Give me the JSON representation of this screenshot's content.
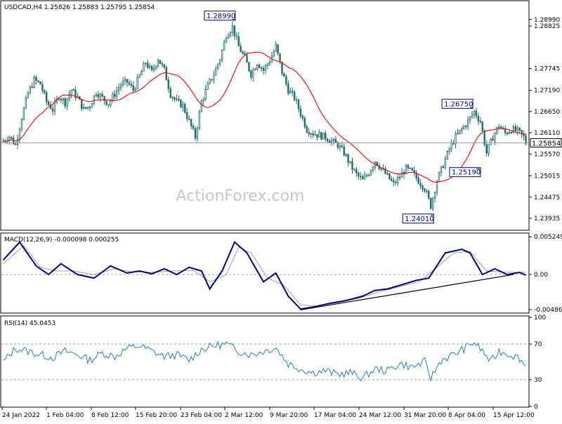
{
  "watermark": "ActionForex.com",
  "colors": {
    "candle": "#1f6f6f",
    "ma": "#ff0000",
    "macd": "#000080",
    "signal": "#a0a0a0",
    "rsi": "#1e7fd0",
    "callout": "#000080",
    "gridline": "#a0a0a0"
  },
  "chart_data": [
    {
      "type": "candlestick",
      "title": "USDCAD,H4  1.25826 1.25883 1.25795 1.25854",
      "ylim": [
        1.2365,
        1.2945
      ],
      "yticks": [
        "1.28990",
        "1.28825",
        "1.27745",
        "1.27190",
        "1.26650",
        "1.26110",
        "1.25570",
        "1.25015",
        "1.24475",
        "1.23935"
      ],
      "xticks": [
        "24 Jan 2022",
        "1 Feb 04:00",
        "8 Feb 12:00",
        "15 Feb 20:00",
        "23 Feb 04:00",
        "2 Mar 12:00",
        "9 Mar 20:00",
        "17 Mar 04:00",
        "24 Mar 12:00",
        "31 Mar 20:00",
        "8 Apr 04:00",
        "15 Apr 12:00"
      ],
      "current_price": "1.25854",
      "annotations": [
        {
          "label": "1.28990",
          "value": 1.2899
        },
        {
          "label": "1.26750",
          "value": 1.2675
        },
        {
          "label": "1.25190",
          "value": 1.2519
        },
        {
          "label": "1.24010",
          "value": 1.2401
        }
      ],
      "close_path": [
        [
          0,
          1.259
        ],
        [
          3,
          1.2602
        ],
        [
          6,
          1.258
        ],
        [
          9,
          1.265
        ],
        [
          12,
          1.2712
        ],
        [
          15,
          1.2745
        ],
        [
          18,
          1.2735
        ],
        [
          21,
          1.269
        ],
        [
          24,
          1.267
        ],
        [
          27,
          1.2705
        ],
        [
          30,
          1.2688
        ],
        [
          33,
          1.272
        ],
        [
          36,
          1.27
        ],
        [
          39,
          1.267
        ],
        [
          42,
          1.268
        ],
        [
          45,
          1.2715
        ],
        [
          48,
          1.27
        ],
        [
          51,
          1.2685
        ],
        [
          54,
          1.271
        ],
        [
          57,
          1.2735
        ],
        [
          60,
          1.274
        ],
        [
          63,
          1.272
        ],
        [
          66,
          1.2755
        ],
        [
          69,
          1.279
        ],
        [
          72,
          1.2765
        ],
        [
          75,
          1.28
        ],
        [
          78,
          1.277
        ],
        [
          81,
          1.271
        ],
        [
          84,
          1.269
        ],
        [
          87,
          1.268
        ],
        [
          90,
          1.264
        ],
        [
          93,
          1.26
        ],
        [
          96,
          1.269
        ],
        [
          99,
          1.273
        ],
        [
          102,
          1.276
        ],
        [
          105,
          1.28
        ],
        [
          108,
          1.286
        ],
        [
          111,
          1.288
        ],
        [
          114,
          1.283
        ],
        [
          117,
          1.28
        ],
        [
          120,
          1.276
        ],
        [
          123,
          1.279
        ],
        [
          126,
          1.277
        ],
        [
          129,
          1.2795
        ],
        [
          132,
          1.283
        ],
        [
          135,
          1.2765
        ],
        [
          138,
          1.272
        ],
        [
          141,
          1.27
        ],
        [
          144,
          1.266
        ],
        [
          147,
          1.262
        ],
        [
          150,
          1.261
        ],
        [
          153,
          1.2605
        ],
        [
          156,
          1.26
        ],
        [
          159,
          1.259
        ],
        [
          162,
          1.258
        ],
        [
          165,
          1.256
        ],
        [
          168,
          1.253
        ],
        [
          171,
          1.2505
        ],
        [
          174,
          1.249
        ],
        [
          177,
          1.251
        ],
        [
          180,
          1.254
        ],
        [
          183,
          1.252
        ],
        [
          186,
          1.25
        ],
        [
          189,
          1.248
        ],
        [
          192,
          1.25
        ],
        [
          195,
          1.252
        ],
        [
          198,
          1.251
        ],
        [
          201,
          1.249
        ],
        [
          204,
          1.247
        ],
        [
          207,
          1.2425
        ],
        [
          210,
          1.249
        ],
        [
          213,
          1.253
        ],
        [
          216,
          1.257
        ],
        [
          219,
          1.26
        ],
        [
          222,
          1.262
        ],
        [
          225,
          1.264
        ],
        [
          228,
          1.2665
        ],
        [
          231,
          1.264
        ],
        [
          234,
          1.256
        ],
        [
          237,
          1.26
        ],
        [
          240,
          1.263
        ],
        [
          243,
          1.261
        ],
        [
          246,
          1.262
        ],
        [
          249,
          1.2615
        ],
        [
          252,
          1.26
        ],
        [
          253,
          1.2585
        ]
      ]
    },
    {
      "type": "line",
      "title": "MACD(12,26,9) -0.000098 0.000255",
      "ylim": [
        -0.00525,
        0.00556
      ],
      "yticks": [
        "0.005249",
        "0.00",
        "-0.004865"
      ],
      "series": [
        {
          "name": "MACD",
          "points": [
            [
              0,
              0.002
            ],
            [
              8,
              0.0045
            ],
            [
              16,
              0.0012
            ],
            [
              22,
              0.0
            ],
            [
              28,
              0.0015
            ],
            [
              36,
              0.0
            ],
            [
              44,
              -0.0005
            ],
            [
              52,
              0.0012
            ],
            [
              60,
              0.0002
            ],
            [
              66,
              0.0005
            ],
            [
              72,
              0.0001
            ],
            [
              78,
              0.0008
            ],
            [
              84,
              0.0
            ],
            [
              90,
              0.001
            ],
            [
              96,
              0.0005
            ],
            [
              100,
              -0.002
            ],
            [
              106,
              0.0005
            ],
            [
              112,
              0.0045
            ],
            [
              118,
              0.003
            ],
            [
              126,
              -0.001
            ],
            [
              132,
              0.0002
            ],
            [
              138,
              -0.003
            ],
            [
              144,
              -0.0048
            ],
            [
              150,
              -0.0045
            ],
            [
              158,
              -0.004
            ],
            [
              166,
              -0.0036
            ],
            [
              174,
              -0.003
            ],
            [
              180,
              -0.0022
            ],
            [
              186,
              -0.002
            ],
            [
              192,
              -0.0015
            ],
            [
              200,
              -0.0008
            ],
            [
              206,
              -0.0005
            ],
            [
              214,
              0.003
            ],
            [
              222,
              0.0035
            ],
            [
              226,
              0.003
            ],
            [
              232,
              0.0
            ],
            [
              238,
              0.0008
            ],
            [
              244,
              0.0
            ],
            [
              250,
              0.0003
            ],
            [
              253,
              -0.0001
            ]
          ]
        },
        {
          "name": "Signal",
          "points": [
            [
              0,
              0.0015
            ],
            [
              10,
              0.004
            ],
            [
              18,
              0.001
            ],
            [
              26,
              0.0005
            ],
            [
              34,
              0.0005
            ],
            [
              44,
              0.0
            ],
            [
              54,
              0.0008
            ],
            [
              62,
              0.0004
            ],
            [
              72,
              0.0003
            ],
            [
              82,
              0.0005
            ],
            [
              92,
              0.0006
            ],
            [
              100,
              -0.001
            ],
            [
              108,
              0.0
            ],
            [
              114,
              0.0038
            ],
            [
              120,
              0.003
            ],
            [
              128,
              -0.0005
            ],
            [
              136,
              -0.0015
            ],
            [
              144,
              -0.0042
            ],
            [
              152,
              -0.0044
            ],
            [
              162,
              -0.0039
            ],
            [
              172,
              -0.0033
            ],
            [
              182,
              -0.0024
            ],
            [
              192,
              -0.0017
            ],
            [
              202,
              -0.0009
            ],
            [
              210,
              0.001
            ],
            [
              218,
              0.003
            ],
            [
              226,
              0.0032
            ],
            [
              234,
              0.0005
            ],
            [
              244,
              0.0003
            ],
            [
              253,
              0.0003
            ]
          ]
        }
      ]
    },
    {
      "type": "line",
      "title": "RSI(14) 45.0453",
      "ylim": [
        0,
        100
      ],
      "yticks": [
        "100",
        "70",
        "30",
        "0"
      ],
      "series": [
        {
          "name": "RSI",
          "points": [
            [
              0,
              50
            ],
            [
              6,
              65
            ],
            [
              12,
              62
            ],
            [
              18,
              58
            ],
            [
              24,
              55
            ],
            [
              30,
              62
            ],
            [
              36,
              58
            ],
            [
              42,
              52
            ],
            [
              48,
              60
            ],
            [
              54,
              56
            ],
            [
              60,
              65
            ],
            [
              66,
              68
            ],
            [
              72,
              62
            ],
            [
              78,
              56
            ],
            [
              84,
              58
            ],
            [
              90,
              52
            ],
            [
              96,
              64
            ],
            [
              102,
              68
            ],
            [
              108,
              70
            ],
            [
              114,
              62
            ],
            [
              120,
              58
            ],
            [
              126,
              62
            ],
            [
              132,
              66
            ],
            [
              138,
              48
            ],
            [
              144,
              42
            ],
            [
              150,
              38
            ],
            [
              156,
              40
            ],
            [
              162,
              36
            ],
            [
              168,
              38
            ],
            [
              174,
              32
            ],
            [
              180,
              42
            ],
            [
              186,
              40
            ],
            [
              192,
              48
            ],
            [
              198,
              44
            ],
            [
              204,
              50
            ],
            [
              207,
              32
            ],
            [
              212,
              52
            ],
            [
              218,
              58
            ],
            [
              224,
              66
            ],
            [
              228,
              72
            ],
            [
              232,
              62
            ],
            [
              236,
              50
            ],
            [
              240,
              62
            ],
            [
              246,
              58
            ],
            [
              250,
              54
            ],
            [
              253,
              45
            ]
          ]
        }
      ]
    }
  ]
}
